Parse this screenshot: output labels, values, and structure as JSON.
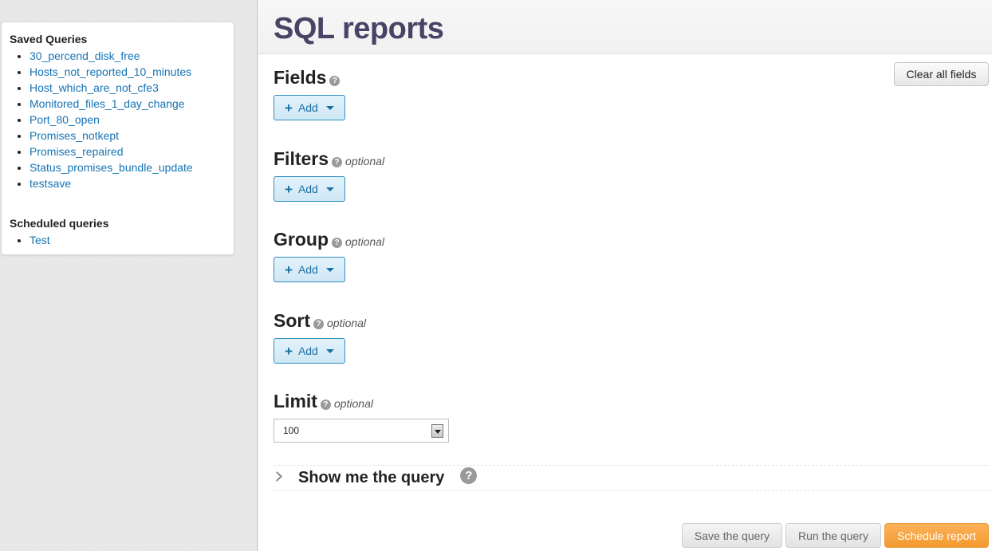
{
  "sidebar": {
    "saved_heading": "Saved Queries",
    "saved_items": [
      "30_percend_disk_free",
      "Hosts_not_reported_10_minutes",
      "Host_which_are_not_cfe3",
      "Monitored_files_1_day_change",
      "Port_80_open",
      "Promises_notkept",
      "Promises_repaired",
      "Status_promises_bundle_update",
      "testsave"
    ],
    "scheduled_heading": "Scheduled queries",
    "scheduled_items": [
      "Test"
    ]
  },
  "header": {
    "title": "SQL reports"
  },
  "clear_button": "Clear all fields",
  "help_icon": "?",
  "sections": {
    "fields": {
      "title": "Fields",
      "optional": "",
      "add": "Add"
    },
    "filters": {
      "title": "Filters",
      "optional": "optional",
      "add": "Add"
    },
    "group": {
      "title": "Group",
      "optional": "optional",
      "add": "Add"
    },
    "sort": {
      "title": "Sort",
      "optional": "optional",
      "add": "Add"
    },
    "limit": {
      "title": "Limit",
      "optional": "optional",
      "value": "100"
    }
  },
  "query_toggle": {
    "label": "Show me the query"
  },
  "footer": {
    "save": "Save the query",
    "run": "Run the query",
    "schedule": "Schedule report"
  },
  "colors": {
    "title": "#4a4366",
    "link": "#1473b5",
    "add_border": "#2f8fc2",
    "schedule": "#f39a2f"
  }
}
